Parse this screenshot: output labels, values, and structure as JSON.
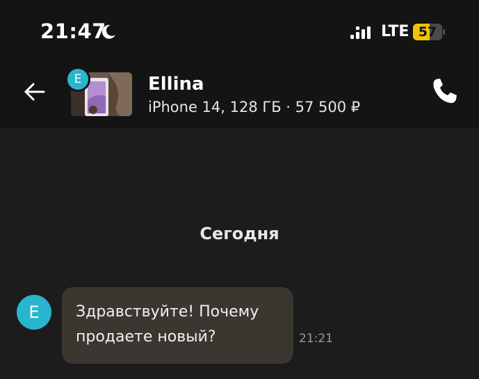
{
  "status_bar": {
    "time": "21:47",
    "network": "LTE",
    "battery_level": "57",
    "battery_fraction": 0.57,
    "moon_icon": "moon-icon",
    "signal_icon": "signal-bars-icon"
  },
  "header": {
    "back_icon": "arrow-left-icon",
    "avatar_initial": "E",
    "contact_name": "Ellina",
    "item_info": "iPhone 14, 128 ГБ · 57 500 ₽",
    "call_icon": "phone-icon"
  },
  "chat": {
    "date_divider": "Сегодня",
    "messages": [
      {
        "avatar_initial": "E",
        "line1": "Здравствуйте! Почему",
        "line2": "продаете новый?",
        "time": "21:21"
      }
    ]
  },
  "colors": {
    "background": "#1c1c1c",
    "header_background": "#141414",
    "avatar": "#2ab5cf",
    "bubble": "#3a3731",
    "battery": "#f2c400"
  }
}
